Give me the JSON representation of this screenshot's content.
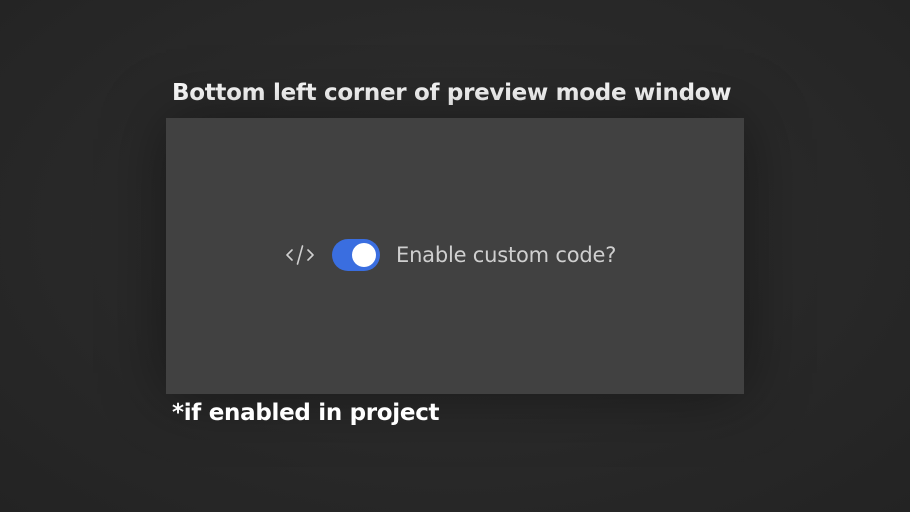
{
  "heading": "Bottom left corner of preview mode window",
  "panel": {
    "code_icon": "code-icon",
    "toggle": {
      "state": "on",
      "accent_color": "#3a6ee0",
      "label": "Enable custom code?"
    }
  },
  "footnote": "*if enabled in project",
  "colors": {
    "background": "#2a2a2a",
    "panel": "#414141",
    "label": "#cfcfcf"
  }
}
